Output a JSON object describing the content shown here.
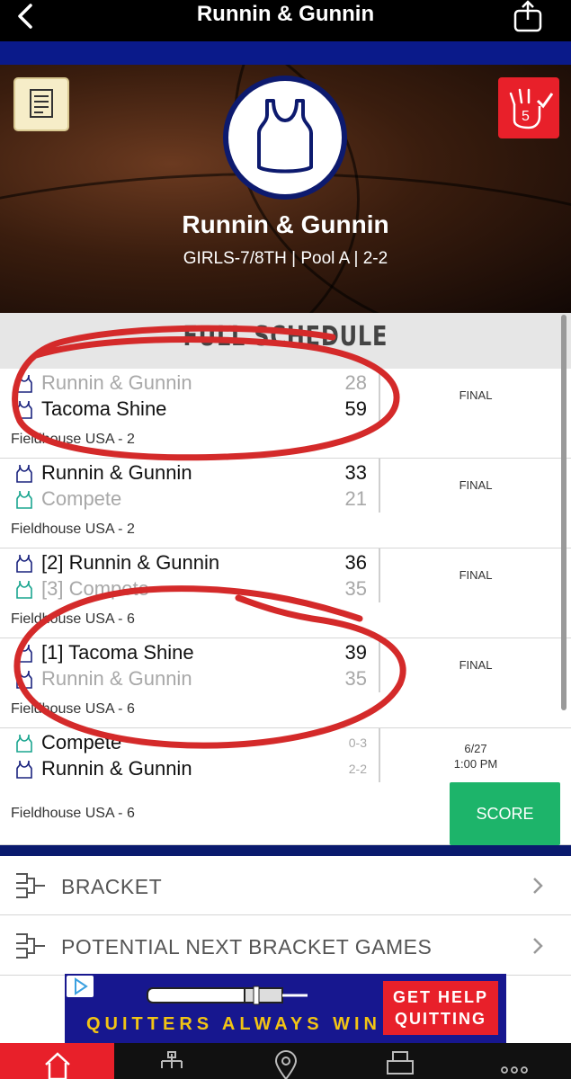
{
  "header": {
    "title": "Runnin & Gunnin"
  },
  "team": {
    "name": "Runnin & Gunnin",
    "subtitle": "GIRLS-7/8TH | Pool A | 2-2"
  },
  "schedule": {
    "title": "FULL SCHEDULE",
    "games": [
      {
        "team1": "Runnin & Gunnin",
        "score1": "28",
        "team2": "Tacoma Shine",
        "score2": "59",
        "status": "FINAL",
        "location": "Fieldhouse USA - 2"
      },
      {
        "team1": "Runnin & Gunnin",
        "score1": "33",
        "team2": "Compete",
        "score2": "21",
        "status": "FINAL",
        "location": "Fieldhouse USA - 2"
      },
      {
        "team1": "[2] Runnin & Gunnin",
        "score1": "36",
        "team2": "[3] Compete",
        "score2": "35",
        "status": "FINAL",
        "location": "Fieldhouse USA - 6"
      },
      {
        "team1": "[1] Tacoma Shine",
        "score1": "39",
        "team2": "Runnin & Gunnin",
        "score2": "35",
        "status": "FINAL",
        "location": "Fieldhouse USA - 6"
      },
      {
        "team1": "Compete",
        "score1": "0-3",
        "team2": "Runnin & Gunnin",
        "score2": "2-2",
        "status_date": "6/27",
        "status_time": "1:00 PM",
        "location": "Fieldhouse USA - 6",
        "button": "SCORE"
      }
    ]
  },
  "menu": [
    {
      "label": "BRACKET"
    },
    {
      "label": "POTENTIAL NEXT BRACKET GAMES"
    }
  ],
  "ad": {
    "text": "QUITTERS ALWAYS WIN",
    "button_line1": "GET HELP",
    "button_line2": "QUITTING"
  },
  "colors": {
    "navy": "#0a1a6e",
    "red": "#e8202a",
    "green": "#1db46a",
    "annotation": "#d42a2a"
  },
  "icons": [
    "back-icon",
    "share-icon",
    "notes-icon",
    "vote-icon",
    "jersey-icon",
    "bracket-icon",
    "chevron-right-icon",
    "home-icon",
    "tree-icon",
    "map-pin-icon",
    "printer-icon",
    "more-icon"
  ]
}
